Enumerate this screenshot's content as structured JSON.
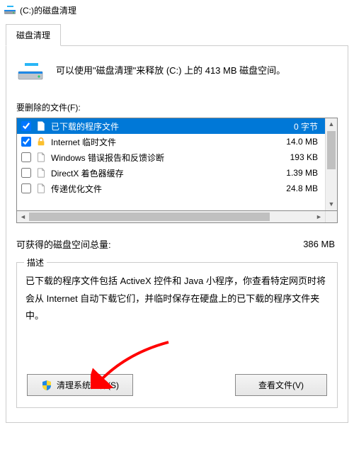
{
  "window": {
    "title": "(C:)的磁盘清理"
  },
  "tab": {
    "label": "磁盘清理"
  },
  "info": {
    "text": "可以使用\"磁盘清理\"来释放  (C:) 上的 413 MB 磁盘空间。"
  },
  "files": {
    "label": "要删除的文件(F):",
    "items": [
      {
        "checked": true,
        "icon": "file",
        "label": "已下载的程序文件",
        "size": "0 字节",
        "selected": true
      },
      {
        "checked": true,
        "icon": "lock",
        "label": "Internet 临时文件",
        "size": "14.0 MB"
      },
      {
        "checked": false,
        "icon": "file",
        "label": "Windows 错误报告和反馈诊断",
        "size": "193 KB"
      },
      {
        "checked": false,
        "icon": "file",
        "label": "DirectX 着色器缓存",
        "size": "1.39 MB"
      },
      {
        "checked": false,
        "icon": "file",
        "label": "传递优化文件",
        "size": "24.8 MB"
      }
    ]
  },
  "gain": {
    "label": "可获得的磁盘空间总量:",
    "value": "386 MB"
  },
  "description": {
    "legend": "描述",
    "text": "已下载的程序文件包括 ActiveX 控件和 Java 小程序，你查看特定网页时将会从 Internet 自动下载它们，并临时保存在硬盘上的已下载的程序文件夹中。"
  },
  "buttons": {
    "clean_system": "清理系统文件(S)",
    "view_files": "查看文件(V)"
  }
}
